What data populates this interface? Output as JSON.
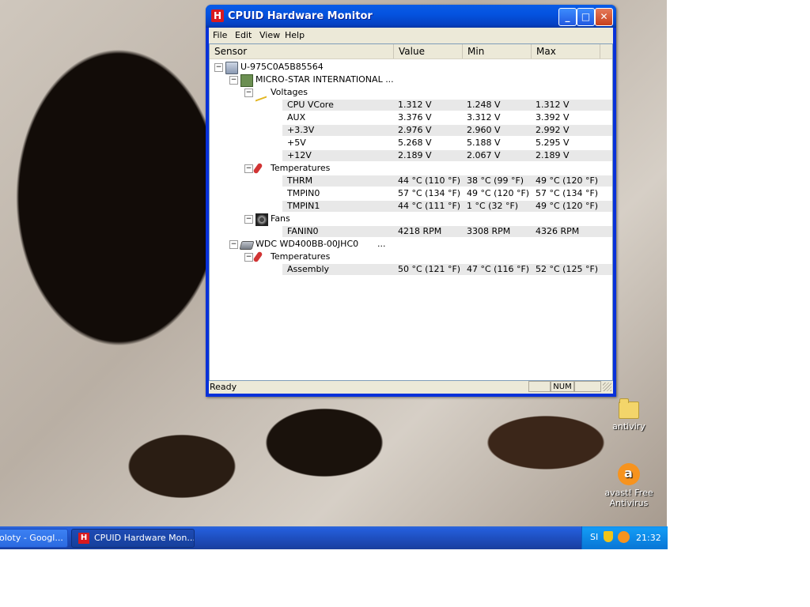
{
  "window": {
    "title": "CPUID Hardware Monitor",
    "app_icon": "H",
    "controls": {
      "minimize": "_",
      "maximize": "□",
      "close": "✕"
    }
  },
  "menu": [
    "File",
    "Edit",
    "View",
    "Help"
  ],
  "columns": [
    "Sensor",
    "Value",
    "Min",
    "Max"
  ],
  "tree": [
    {
      "label": "U-975C0A5B85564",
      "icon": "computer-icon",
      "level": 0,
      "expander": "−"
    },
    {
      "label": "MICRO-STAR INTERNATIONAL ...",
      "icon": "motherboard-icon",
      "level": 1,
      "expander": "−"
    },
    {
      "label": "Voltages",
      "icon": "voltage-icon",
      "level": 2,
      "expander": "−"
    },
    {
      "label": "CPU VCore",
      "level": 3,
      "value": "1.312 V",
      "min": "1.248 V",
      "max": "1.312 V",
      "shaded": true
    },
    {
      "label": "AUX",
      "level": 3,
      "value": "3.376 V",
      "min": "3.312 V",
      "max": "3.392 V"
    },
    {
      "label": "+3.3V",
      "level": 3,
      "value": "2.976 V",
      "min": "2.960 V",
      "max": "2.992 V",
      "shaded": true
    },
    {
      "label": "+5V",
      "level": 3,
      "value": "5.268 V",
      "min": "5.188 V",
      "max": "5.295 V"
    },
    {
      "label": "+12V",
      "level": 3,
      "value": "2.189 V",
      "min": "2.067 V",
      "max": "2.189 V",
      "shaded": true
    },
    {
      "label": "Temperatures",
      "icon": "thermometer-icon",
      "level": 2,
      "expander": "−"
    },
    {
      "label": "THRM",
      "level": 3,
      "value": "44 °C  (110 °F)",
      "min": "38 °C  (99 °F)",
      "max": "49 °C  (120 °F)",
      "shaded": true
    },
    {
      "label": "TMPIN0",
      "level": 3,
      "value": "57 °C  (134 °F)",
      "min": "49 °C  (120 °F)",
      "max": "57 °C  (134 °F)"
    },
    {
      "label": "TMPIN1",
      "level": 3,
      "value": "44 °C  (111 °F)",
      "min": "1 °C  (32 °F)",
      "max": "49 °C  (120 °F)",
      "shaded": true
    },
    {
      "label": "Fans",
      "icon": "fan-icon",
      "level": 2,
      "expander": "−"
    },
    {
      "label": "FANIN0",
      "level": 3,
      "value": "4218 RPM",
      "min": "3308 RPM",
      "max": "4326 RPM",
      "shaded": true
    },
    {
      "label": "WDC WD400BB-00JHC0",
      "icon": "hard-drive-icon",
      "level": 1,
      "expander": "−",
      "value": "..."
    },
    {
      "label": "Temperatures",
      "icon": "thermometer-icon",
      "level": 2,
      "expander": "−"
    },
    {
      "label": "Assembly",
      "level": 3,
      "value": "50 °C  (121 °F)",
      "min": "47 °C  (116 °F)",
      "max": "52 °C  (125 °F)",
      "shaded": true
    }
  ],
  "statusbar": {
    "text": "Ready",
    "num": "NUM"
  },
  "desktop_icons": [
    {
      "label": "antiviry",
      "icon": "folder-icon"
    },
    {
      "label": "avast! Free Antivirus",
      "icon": "avast-icon"
    }
  ],
  "taskbar": {
    "buttons": [
      {
        "label": "oloty - Googl...",
        "active": false
      },
      {
        "label": "CPUID Hardware Mon...",
        "active": true,
        "icon": "H"
      }
    ],
    "tray": {
      "lang": "SI",
      "clock": "21:32"
    }
  }
}
